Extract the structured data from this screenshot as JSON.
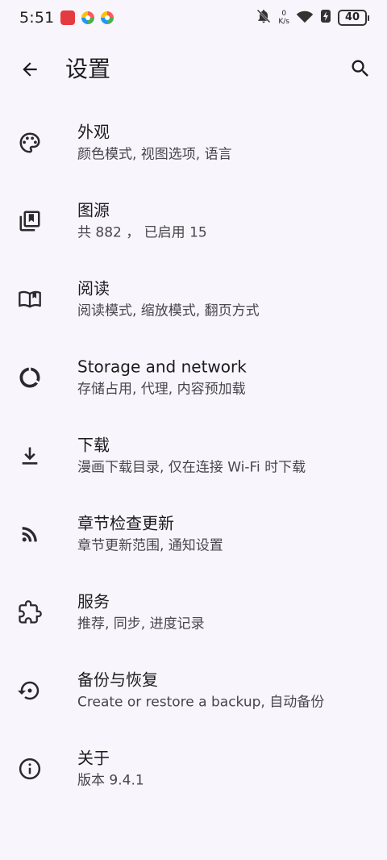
{
  "status_bar": {
    "time": "5:51",
    "net_speed_value": "0",
    "net_speed_unit": "K/s",
    "battery_level": "40",
    "app_icons": [
      "app-icon-red",
      "pinwheel-app-icon",
      "pinwheel-app-icon"
    ],
    "icons": [
      "notifications-off-icon",
      "wifi-icon",
      "charging-icon"
    ]
  },
  "app_bar": {
    "title": "设置",
    "back_icon": "arrow-back-icon",
    "search_icon": "search-icon"
  },
  "settings": [
    {
      "icon": "palette-icon",
      "title": "外观",
      "summary": "颜色模式, 视图选项, 语言"
    },
    {
      "icon": "library-icon",
      "title": "图源",
      "summary": "共 882 ，  已启用 15"
    },
    {
      "icon": "book-open-icon",
      "title": "阅读",
      "summary": "阅读模式, 缩放模式, 翻页方式"
    },
    {
      "icon": "storage-circle-icon",
      "title": "Storage and network",
      "summary": "存储占用, 代理, 内容预加载"
    },
    {
      "icon": "download-icon",
      "title": "下载",
      "summary": "漫画下载目录, 仅在连接 Wi-Fi 时下载"
    },
    {
      "icon": "rss-feed-icon",
      "title": "章节检查更新",
      "summary": "章节更新范围, 通知设置"
    },
    {
      "icon": "extension-puzzle-icon",
      "title": "服务",
      "summary": "推荐, 同步, 进度记录"
    },
    {
      "icon": "backup-restore-icon",
      "title": "备份与恢复",
      "summary": "Create or restore a backup, 自动备份"
    },
    {
      "icon": "info-icon",
      "title": "关于",
      "summary": "版本 9.4.1"
    }
  ],
  "colors": {
    "background": "#f8f6fc",
    "text_primary": "#1c1b1f",
    "text_secondary": "#48464c",
    "icon": "#2b2930"
  }
}
